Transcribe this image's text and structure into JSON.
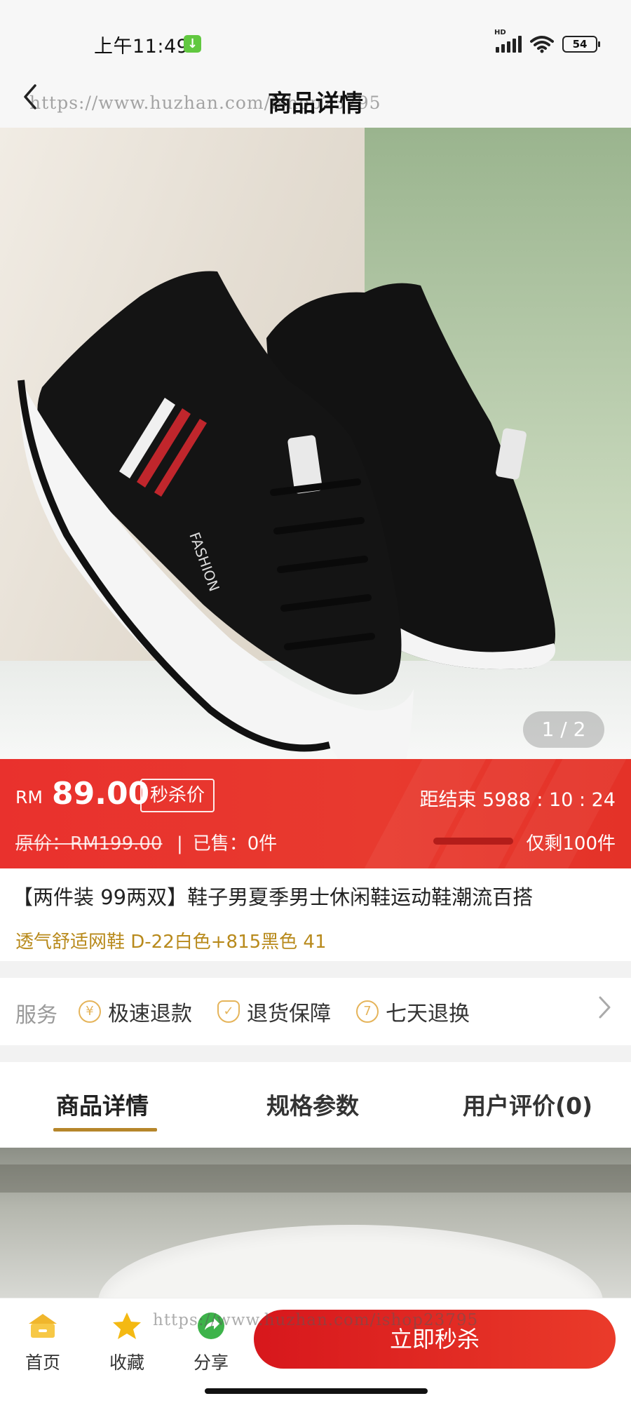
{
  "status_bar": {
    "time": "上午11:49",
    "battery": "54",
    "network": "HD"
  },
  "header": {
    "title": "商品详情",
    "watermark": "https://www.huzhan.com/ishop23795"
  },
  "gallery": {
    "counter": "1 / 2"
  },
  "price_banner": {
    "currency": "RM",
    "price": "89.00",
    "flash_tag": "秒杀价",
    "original_price": "原价：RM199.00",
    "sold": "已售：0件",
    "countdown": "距结束 5988 : 10 : 24",
    "remaining": "仅剩100件",
    "remaining_progress": 1.0
  },
  "product": {
    "title": "【两件装 99两双】鞋子男夏季男士休闲鞋运动鞋潮流百搭",
    "subtitle": "透气舒适网鞋 D-22白色+815黑色 41"
  },
  "services": {
    "label": "服务",
    "items": [
      {
        "label": "极速退款",
        "icon": "yen-icon"
      },
      {
        "label": "退货保障",
        "icon": "shield-icon"
      },
      {
        "label": "七天退换",
        "icon": "seven-day-icon"
      }
    ]
  },
  "tabs": [
    {
      "label": "商品详情",
      "active": true
    },
    {
      "label": "规格参数",
      "active": false
    },
    {
      "label": "用户评价(0)",
      "active": false
    }
  ],
  "bottom_bar": {
    "nav": [
      {
        "label": "首页",
        "icon": "home-icon"
      },
      {
        "label": "收藏",
        "icon": "star-icon"
      },
      {
        "label": "分享",
        "icon": "share-icon"
      }
    ],
    "buy_button": "立即秒杀",
    "watermark": "https://www.huzhan.com/ishop23795"
  },
  "colors": {
    "accent_red": "#e9312d",
    "gold": "#b88a1c",
    "icon_gold": "#e5b45a"
  }
}
